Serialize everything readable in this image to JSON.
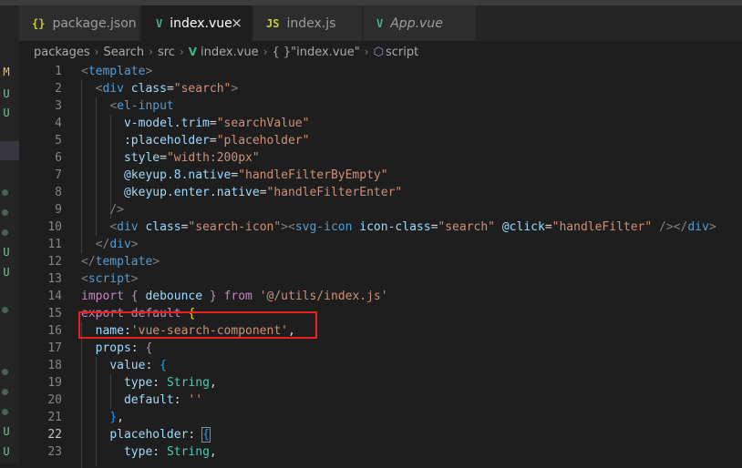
{
  "tabs": [
    {
      "icon": "{}",
      "label": "package.json",
      "active": false,
      "italic": false
    },
    {
      "icon": "V",
      "label": "index.vue",
      "active": true,
      "italic": false,
      "close": "×"
    },
    {
      "icon": "JS",
      "label": "index.js",
      "active": false,
      "italic": false
    },
    {
      "icon": "V",
      "label": "App.vue",
      "active": false,
      "italic": true
    }
  ],
  "breadcrumb": {
    "parts": [
      "packages",
      "Search",
      "src"
    ],
    "file": "index.vue",
    "object": "{ }\"index.vue\"",
    "section": "script",
    "sep": "›"
  },
  "scm_marks": [
    {
      "text": "M",
      "color": "#e2c08d"
    },
    {
      "text": "U",
      "color": "#73c991"
    },
    {
      "text": "U",
      "color": "#73c991"
    },
    {
      "text": "U",
      "color": "#73c991"
    },
    {
      "text": "U",
      "color": "#73c991"
    },
    {
      "text": "U",
      "color": "#73c991"
    },
    {
      "text": "U",
      "color": "#73c991"
    }
  ],
  "line_numbers": [
    "1",
    "2",
    "3",
    "4",
    "5",
    "6",
    "7",
    "8",
    "9",
    "10",
    "11",
    "12",
    "13",
    "14",
    "15",
    "16",
    "17",
    "18",
    "19",
    "20",
    "21",
    "22",
    "23"
  ],
  "code": {
    "l1": [
      "<",
      "template",
      ">"
    ],
    "l2": [
      "<",
      "div",
      " ",
      "class",
      "=",
      "\"search\"",
      ">"
    ],
    "l3": [
      "<",
      "el-input"
    ],
    "l4": [
      "v-model.trim",
      "=",
      "\"searchValue\""
    ],
    "l5": [
      ":placeholder",
      "=",
      "\"placeholder\""
    ],
    "l6": [
      "style",
      "=",
      "\"width:200px\""
    ],
    "l7": [
      "@keyup.8.native",
      "=",
      "\"handleFilterByEmpty\""
    ],
    "l8": [
      "@keyup.enter.native",
      "=",
      "\"handleFilterEnter\""
    ],
    "l9": [
      "/>"
    ],
    "l10": [
      "<",
      "div",
      " ",
      "class",
      "=",
      "\"search-icon\"",
      "><",
      "svg-icon",
      " ",
      "icon-class",
      "=",
      "\"search\"",
      " ",
      "@click",
      "=",
      "\"handleFilter\"",
      " /></",
      "div",
      ">"
    ],
    "l11": [
      "</",
      "div",
      ">"
    ],
    "l12": [
      "</",
      "template",
      ">"
    ],
    "l13": [
      "<",
      "script",
      ">"
    ],
    "l14": [
      "import",
      " ",
      "{",
      " debounce ",
      "}",
      " ",
      "from",
      " ",
      "'@/utils/index.js'"
    ],
    "l15": [
      "export",
      " ",
      "default",
      " ",
      "{"
    ],
    "l16": [
      "name",
      ":",
      "'vue-search-component'",
      ","
    ],
    "l17": [
      "props",
      ": ",
      "{"
    ],
    "l18": [
      "value",
      ": ",
      "{"
    ],
    "l19": [
      "type",
      ": ",
      "String",
      ","
    ],
    "l20": [
      "default",
      ": ",
      "''"
    ],
    "l21": [
      "}",
      ","
    ],
    "l22": [
      "placeholder",
      ": ",
      "{"
    ],
    "l23": [
      "type",
      ": ",
      "String",
      ","
    ]
  },
  "colors": {
    "editor_bg": "#1e1e1e",
    "tag": "#569cd6",
    "attribute": "#9cdcfe",
    "string": "#ce9178",
    "keyword": "#c586c0",
    "highlight_box": "#e8211a",
    "vue_green": "#41b883",
    "js_yellow": "#cbcb41"
  }
}
